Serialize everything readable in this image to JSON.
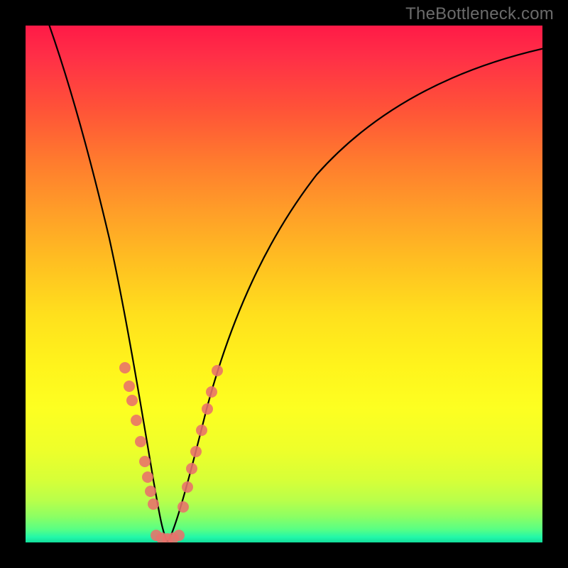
{
  "attribution": "TheBottleneck.com",
  "chart_data": {
    "type": "line",
    "title": "",
    "xlabel": "",
    "ylabel": "",
    "xlim": [
      0,
      100
    ],
    "ylim": [
      0,
      100
    ],
    "background_gradient": {
      "stops": [
        {
          "pos": 0,
          "color": "#ff1a47"
        },
        {
          "pos": 50,
          "color": "#ffd21e"
        },
        {
          "pos": 90,
          "color": "#d6ff38"
        },
        {
          "pos": 100,
          "color": "#12dd9a"
        }
      ]
    },
    "curve": {
      "description": "V-shaped bottleneck curve; y approaches 0 at minimum near x≈27, rises steeply to left toward 100 and more gently to right toward ~72 at x=100",
      "minimum_x": 27,
      "points_est": [
        {
          "x": 4,
          "y": 100
        },
        {
          "x": 8,
          "y": 88
        },
        {
          "x": 12,
          "y": 72
        },
        {
          "x": 16,
          "y": 54
        },
        {
          "x": 20,
          "y": 34
        },
        {
          "x": 24,
          "y": 12
        },
        {
          "x": 27,
          "y": 0
        },
        {
          "x": 30,
          "y": 10
        },
        {
          "x": 35,
          "y": 24
        },
        {
          "x": 42,
          "y": 38
        },
        {
          "x": 52,
          "y": 50
        },
        {
          "x": 64,
          "y": 60
        },
        {
          "x": 78,
          "y": 67
        },
        {
          "x": 100,
          "y": 72
        }
      ]
    },
    "markers": {
      "color": "#e8716b",
      "radius_px": 8,
      "left_cluster_y_range": [
        8,
        34
      ],
      "right_cluster_y_range": [
        6,
        34
      ],
      "bottom_cluster_y_range": [
        0,
        2
      ],
      "points_est": [
        {
          "x": 19.0,
          "y": 34
        },
        {
          "x": 19.8,
          "y": 30
        },
        {
          "x": 20.6,
          "y": 26
        },
        {
          "x": 21.6,
          "y": 21
        },
        {
          "x": 22.6,
          "y": 17
        },
        {
          "x": 23.4,
          "y": 14
        },
        {
          "x": 24.0,
          "y": 12
        },
        {
          "x": 24.5,
          "y": 10
        },
        {
          "x": 25.0,
          "y": 8
        },
        {
          "x": 25.6,
          "y": 2
        },
        {
          "x": 26.4,
          "y": 1
        },
        {
          "x": 27.2,
          "y": 1
        },
        {
          "x": 28.0,
          "y": 1
        },
        {
          "x": 28.8,
          "y": 1
        },
        {
          "x": 29.6,
          "y": 6
        },
        {
          "x": 30.4,
          "y": 11
        },
        {
          "x": 31.0,
          "y": 14
        },
        {
          "x": 32.0,
          "y": 18
        },
        {
          "x": 33.0,
          "y": 22
        },
        {
          "x": 34.0,
          "y": 26
        },
        {
          "x": 35.0,
          "y": 30
        },
        {
          "x": 36.0,
          "y": 34
        }
      ]
    }
  }
}
